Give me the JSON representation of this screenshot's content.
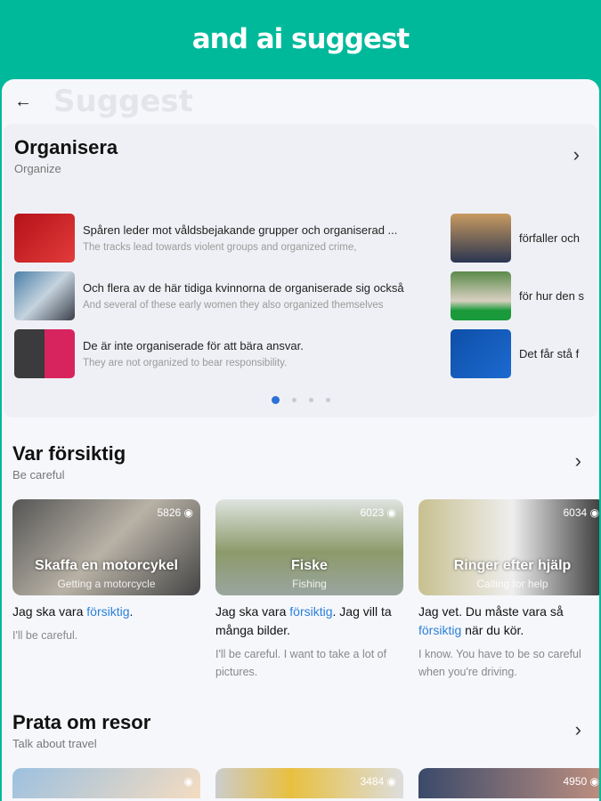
{
  "banner": {
    "title": "and ai suggest"
  },
  "topbar": {
    "ghost_title": "Suggest"
  },
  "organize": {
    "title": "Organisera",
    "subtitle": "Organize",
    "rows": [
      {
        "sv": "Spåren leder mot våldsbejakande grupper och organiserad ...",
        "en": "The tracks lead towards violent groups and organized crime,"
      },
      {
        "sv": "Och flera av de här tidiga kvinnorna de organiserade sig också",
        "en": "And several of these early women they also organized themselves"
      },
      {
        "sv": "De är inte organiserade för att bära ansvar.",
        "en": "They are not organized to bear responsibility."
      }
    ],
    "rows2": [
      {
        "sv": "förfaller och"
      },
      {
        "sv": "för hur den s"
      },
      {
        "sv": "Det får stå f"
      }
    ],
    "page_count": 4,
    "active_page": 1
  },
  "careful": {
    "title": "Var försiktig",
    "subtitle": "Be careful",
    "cards": [
      {
        "count": "5826",
        "title": "Skaffa en motorcykel",
        "subtitle": "Getting a motorcycle",
        "pre": "Jag ska vara ",
        "hl": "försiktig",
        "post": ".",
        "en": "I'll be careful."
      },
      {
        "count": "6023",
        "title": "Fiske",
        "subtitle": "Fishing",
        "pre": "Jag ska vara ",
        "hl": "försiktig",
        "post": ". Jag vill ta många bilder.",
        "en": "I'll be careful. I want to take a lot of pictures."
      },
      {
        "count": "6034",
        "title": "Ringer efter hjälp",
        "subtitle": "Calling for help",
        "pre": "Jag vet. Du måste vara så ",
        "hl": "försiktig",
        "post": " när du kör.",
        "en": "I know. You have to be so careful when you're driving."
      }
    ]
  },
  "travel": {
    "title": "Prata om resor",
    "subtitle": "Talk about travel",
    "cards": [
      {
        "count": ""
      },
      {
        "count": "3484"
      },
      {
        "count": "4950"
      }
    ]
  },
  "colors": {
    "accent": "#00b99b",
    "highlight": "#2a80d8"
  }
}
